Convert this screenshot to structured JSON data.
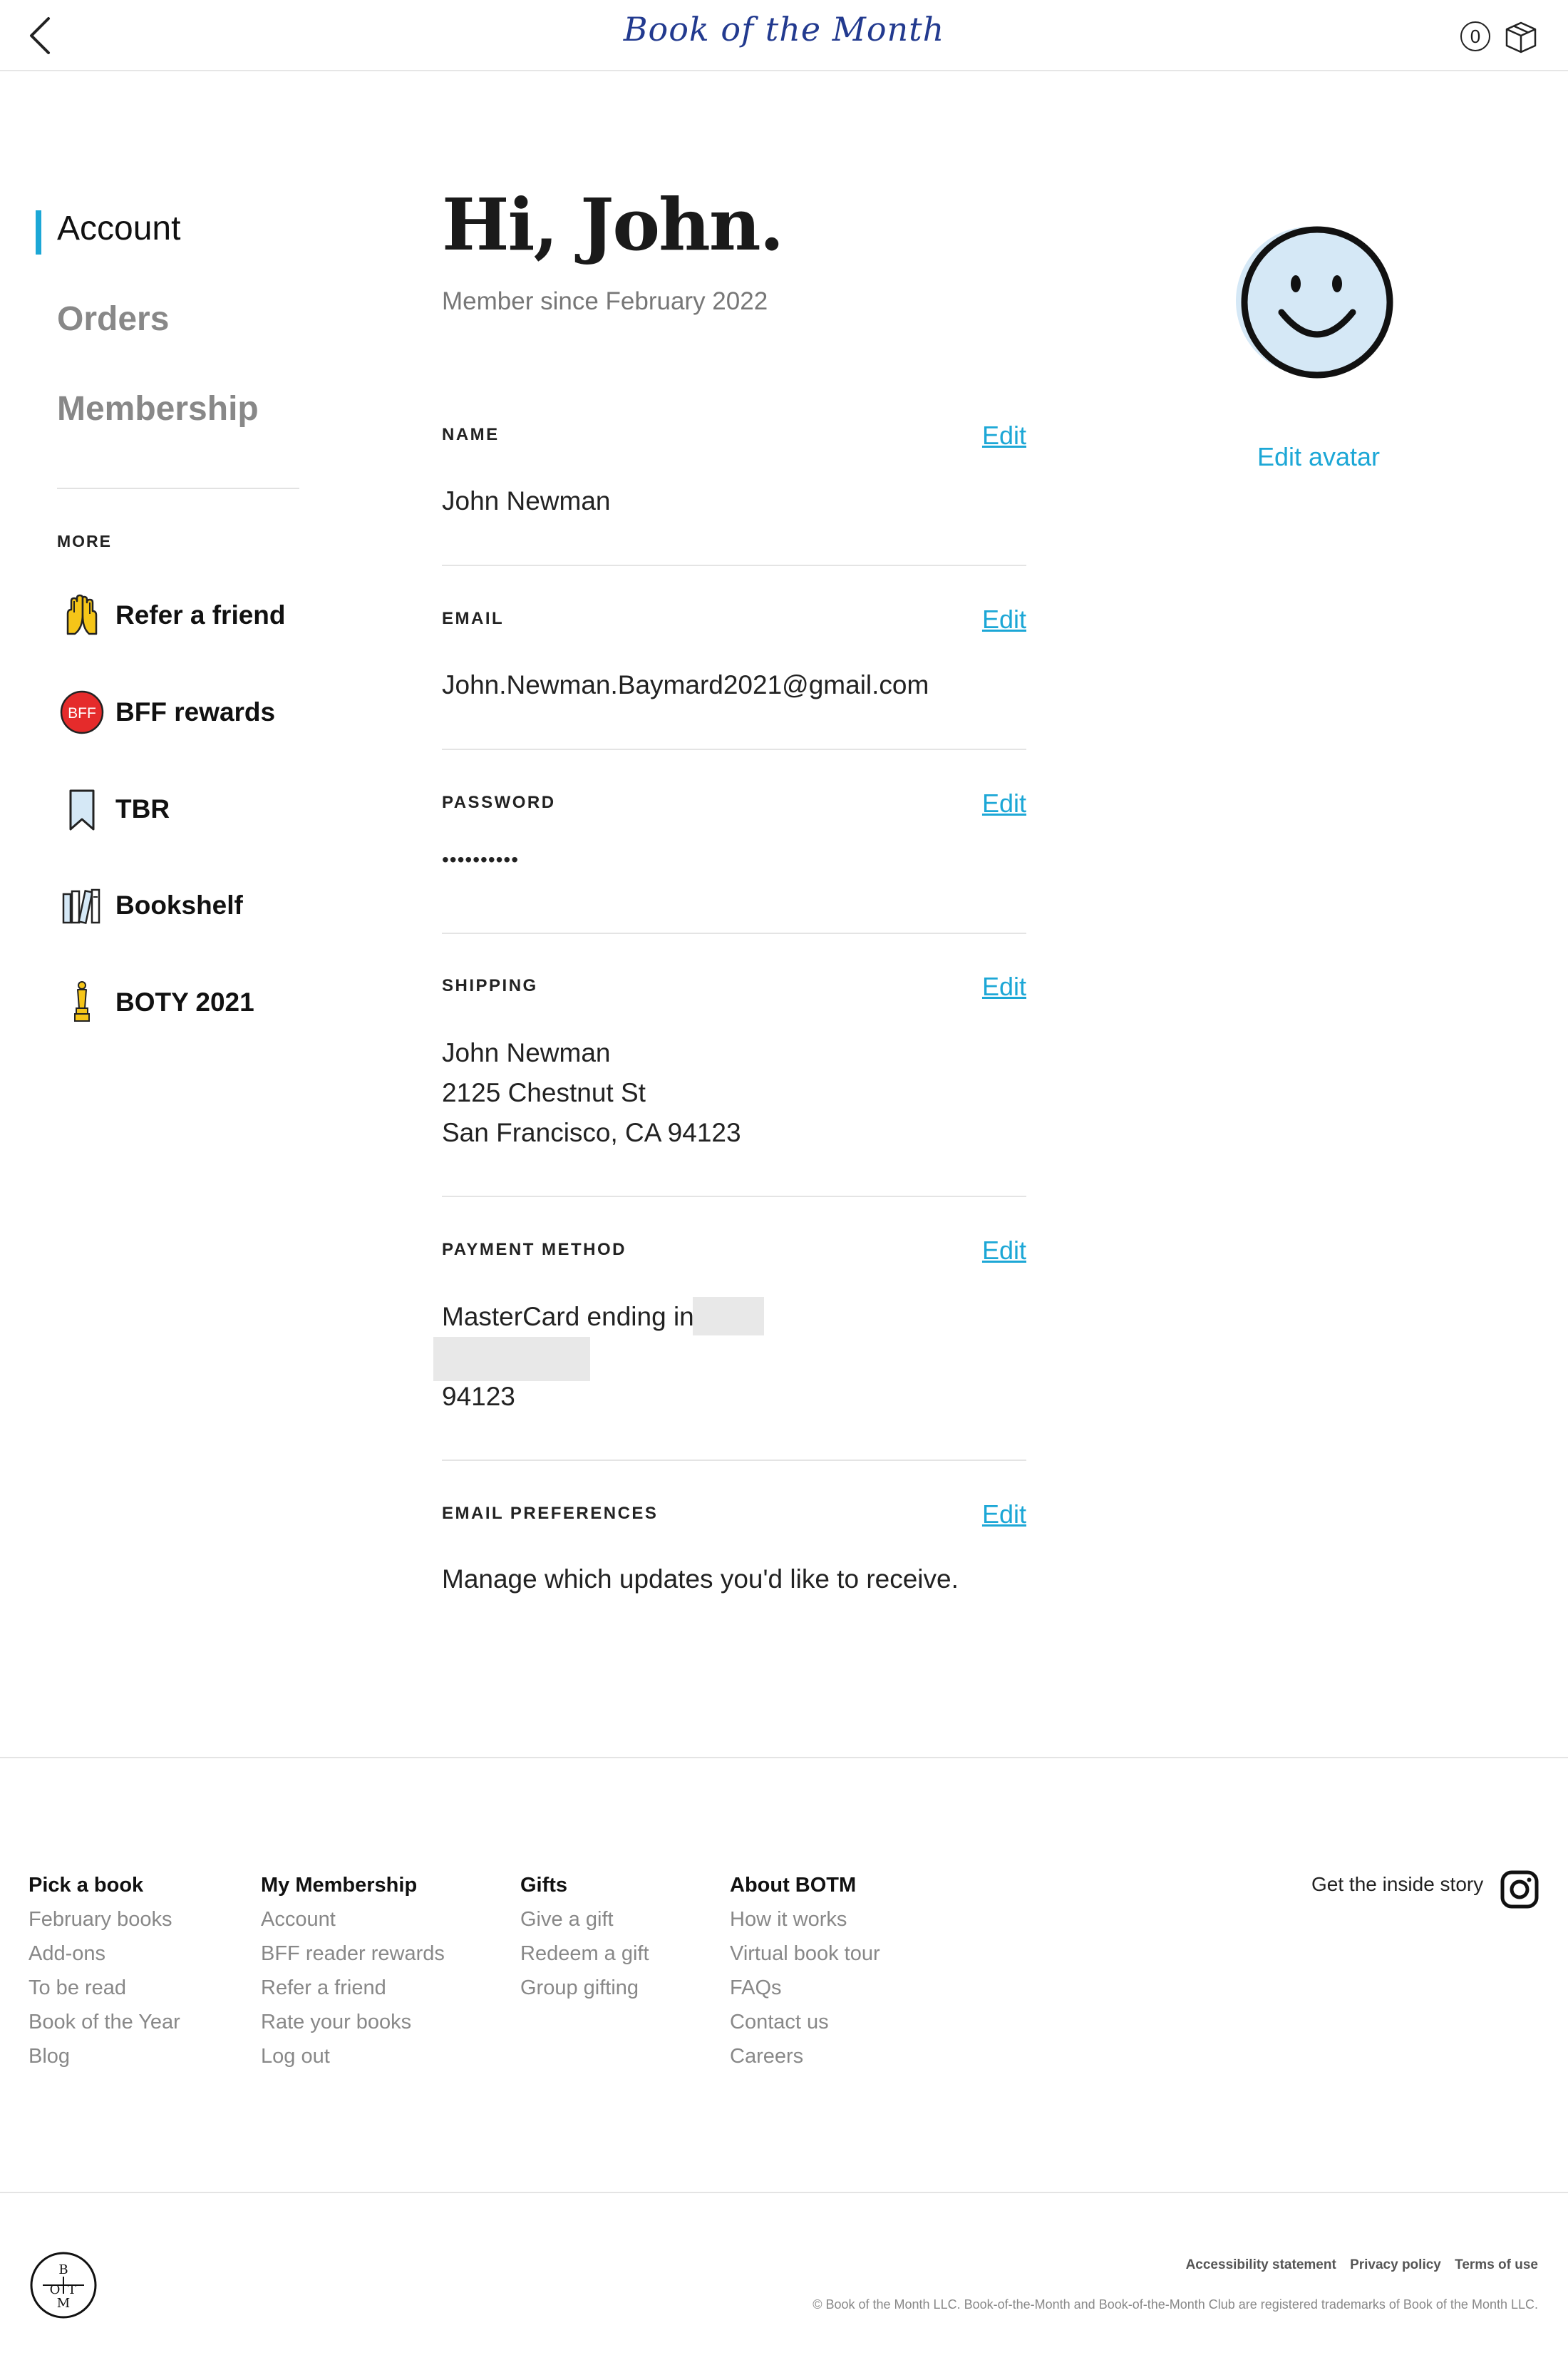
{
  "header": {
    "logo_text": "Book of the Month",
    "cart_count": "0"
  },
  "sidebar": {
    "nav": [
      {
        "label": "Account",
        "active": true
      },
      {
        "label": "Orders",
        "active": false
      },
      {
        "label": "Membership",
        "active": false
      }
    ],
    "more_label": "MORE",
    "more_items": [
      {
        "label": "Refer a friend",
        "icon": "hands-icon"
      },
      {
        "label": "BFF rewards",
        "icon": "bff-badge-icon",
        "badge_text": "BFF"
      },
      {
        "label": "TBR",
        "icon": "bookmark-icon"
      },
      {
        "label": "Bookshelf",
        "icon": "bookshelf-icon"
      },
      {
        "label": "BOTY 2021",
        "icon": "trophy-icon"
      }
    ]
  },
  "main": {
    "greeting": "Hi, John.",
    "member_since": "Member since February 2022",
    "edit_label": "Edit",
    "sections": {
      "name": {
        "label": "NAME",
        "value": "John Newman"
      },
      "email": {
        "label": "EMAIL",
        "value": "John.Newman.Baymard2021@gmail.com"
      },
      "password": {
        "label": "PASSWORD",
        "value": "••••••••••"
      },
      "shipping": {
        "label": "SHIPPING",
        "lines": [
          "John Newman",
          "2125 Chestnut St",
          "San Francisco, CA 94123"
        ]
      },
      "payment": {
        "label": "PAYMENT METHOD",
        "line1": "MasterCard ending in",
        "zip": "94123"
      },
      "email_prefs": {
        "label": "EMAIL PREFERENCES",
        "value": "Manage which updates you'd like to receive."
      }
    }
  },
  "avatar": {
    "edit_label": "Edit avatar",
    "fill_color": "#d5e8f6"
  },
  "footer": {
    "columns": [
      {
        "heading": "Pick a book",
        "links": [
          "February books",
          "Add-ons",
          "To be read",
          "Book of the Year",
          "Blog"
        ]
      },
      {
        "heading": "My Membership",
        "links": [
          "Account",
          "BFF reader rewards",
          "Refer a friend",
          "Rate your books",
          "Log out"
        ]
      },
      {
        "heading": "Gifts",
        "links": [
          "Give a gift",
          "Redeem a gift",
          "Group gifting"
        ]
      },
      {
        "heading": "About BOTM",
        "links": [
          "How it works",
          "Virtual book tour",
          "FAQs",
          "Contact us",
          "Careers"
        ]
      }
    ],
    "inside_story": "Get the inside story",
    "legal_links": [
      "Accessibility statement",
      "Privacy policy",
      "Terms of use"
    ],
    "copyright": "© Book of the Month LLC. Book-of-the-Month and Book-of-the-Month Club are registered trademarks of Book of the Month LLC.",
    "logo_letters": {
      "top": "B",
      "left": "O",
      "right": "T",
      "bottom": "M"
    }
  },
  "colors": {
    "accent": "#1ca7d6",
    "logo_blue": "#223a8f",
    "bff_red": "#e52b2b"
  }
}
